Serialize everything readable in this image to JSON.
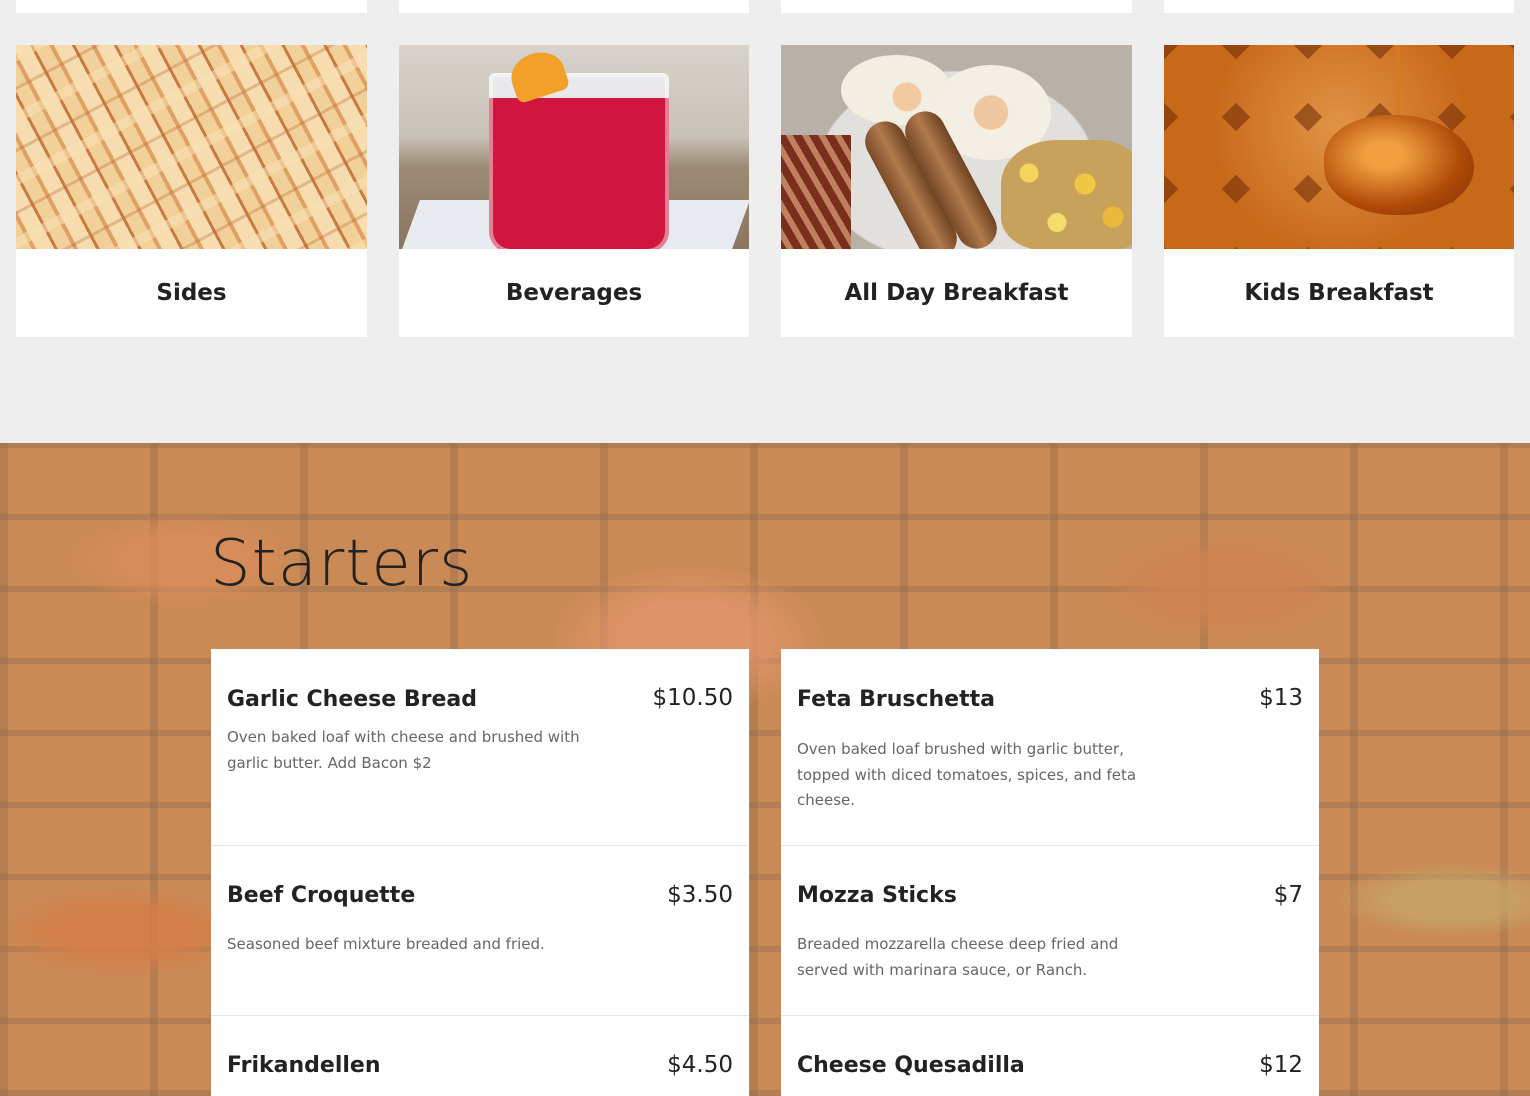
{
  "categories": [
    {
      "label": "Sides",
      "image": "french-fries"
    },
    {
      "label": "Beverages",
      "image": "red-drink"
    },
    {
      "label": "All Day Breakfast",
      "image": "breakfast-plate"
    },
    {
      "label": "Kids Breakfast",
      "image": "waffle-syrup"
    }
  ],
  "starters": {
    "title": "Starters",
    "left": [
      {
        "name": "Garlic Cheese Bread",
        "price": "$10.50",
        "desc": " Oven baked loaf with cheese and brushed with garlic butter.  Add Bacon $2"
      },
      {
        "name": "Beef Croquette",
        "price": "$3.50",
        "desc": "Seasoned beef mixture breaded and fried."
      },
      {
        "name": "Frikandellen",
        "price": "$4.50",
        "desc": ""
      }
    ],
    "right": [
      {
        "name": "Feta Bruschetta",
        "price": "$13",
        "desc": "Oven baked loaf brushed with garlic butter, topped with diced tomatoes, spices, and feta cheese."
      },
      {
        "name": "Mozza Sticks",
        "price": "$7",
        "desc": "Breaded mozzarella cheese deep fried and served with marinara sauce, or Ranch."
      },
      {
        "name": "Cheese Quesadilla",
        "price": "$12",
        "desc": ""
      }
    ]
  }
}
